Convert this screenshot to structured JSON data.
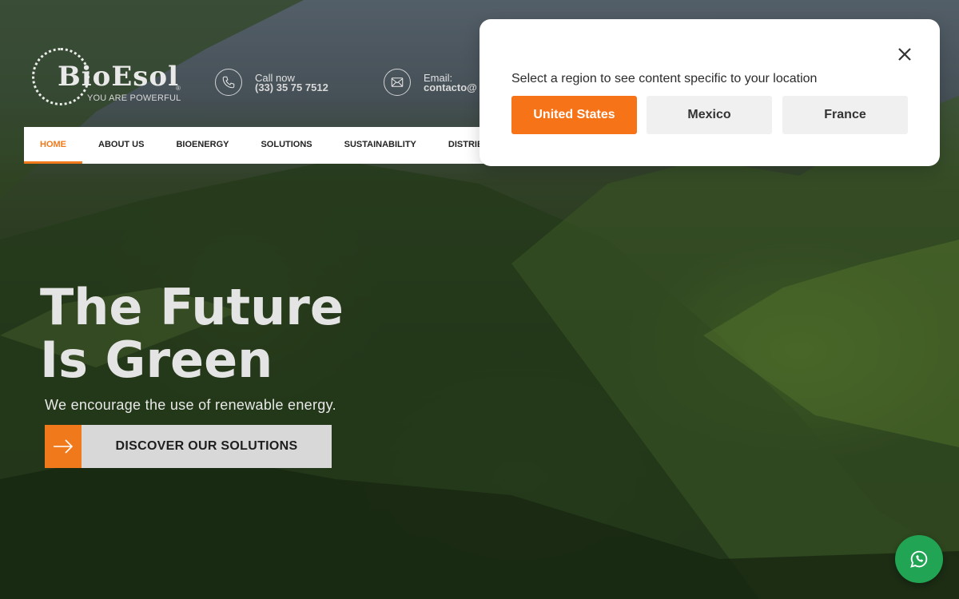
{
  "brand": {
    "name": "BioEsol",
    "registered": "®",
    "tagline": "YOU ARE POWERFUL"
  },
  "contacts": {
    "phone": {
      "label": "Call now",
      "value": "(33) 35 75 7512",
      "icon": "phone-icon"
    },
    "email": {
      "label": "Email:",
      "value": "contacto@",
      "icon": "mail-icon"
    }
  },
  "nav": {
    "items": [
      {
        "label": "HOME",
        "active": true
      },
      {
        "label": "ABOUT US"
      },
      {
        "label": "BIOENERGY"
      },
      {
        "label": "SOLUTIONS"
      },
      {
        "label": "SUSTAINABILITY"
      },
      {
        "label": "DISTRIBUTORS"
      }
    ]
  },
  "hero": {
    "title_line1": "The Future",
    "title_line2": "Is Green",
    "subtitle": "We encourage the use of renewable energy.",
    "cta_label": "DISCOVER OUR SOLUTIONS",
    "cta_icon": "arrow-right-icon"
  },
  "region_modal": {
    "prompt": "Select a region to see content specific to your location",
    "close_icon": "close-icon",
    "options": [
      "United States",
      "Mexico",
      "France"
    ],
    "selected": "United States"
  },
  "colors": {
    "accent": "#f07a1b",
    "region_primary": "#f77318",
    "whatsapp": "#22a455"
  },
  "floating": {
    "icon": "whatsapp-icon"
  }
}
